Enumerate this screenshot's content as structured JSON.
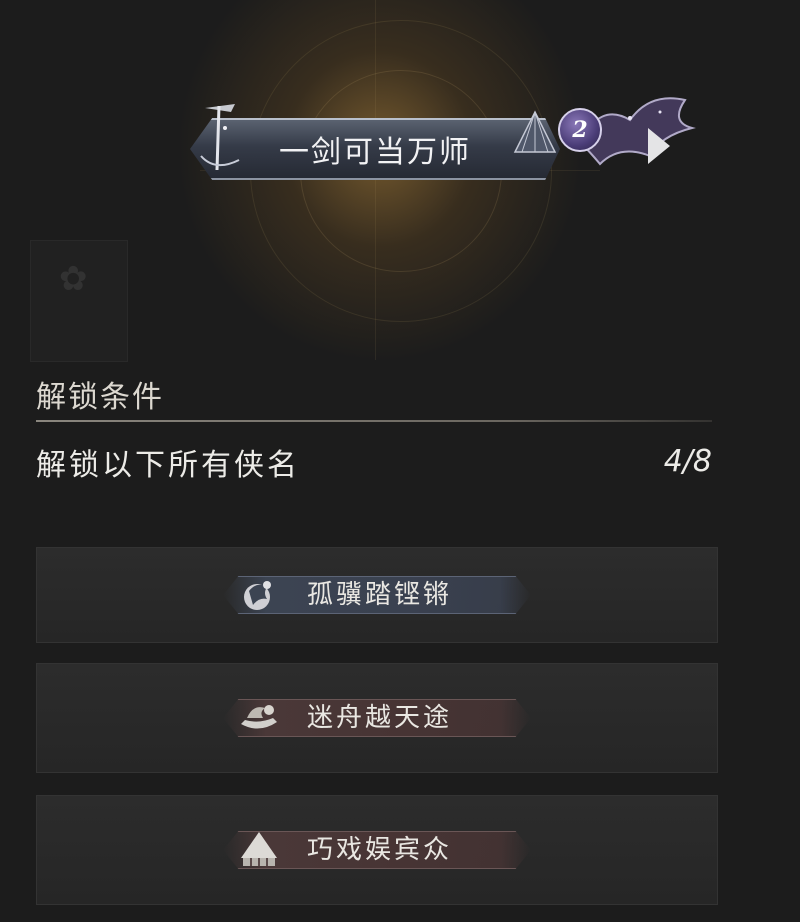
{
  "title": {
    "name": "一剑可当万师",
    "level": "2"
  },
  "unlock": {
    "heading": "解锁条件",
    "condition": "解锁以下所有侠名",
    "progress_text": "4/8"
  },
  "titles_list": [
    {
      "label": "孤骥踏铿锵",
      "icon": "horse-emblem-icon"
    },
    {
      "label": "迷舟越天途",
      "icon": "boat-emblem-icon"
    },
    {
      "label": "巧戏娱宾众",
      "icon": "pavilion-emblem-icon"
    }
  ],
  "colors": {
    "background": "#1c1c1c",
    "banner": "#353b48",
    "badge": "#4b3d78",
    "card": "#2a2a2a",
    "text": "#e8e6e1"
  }
}
